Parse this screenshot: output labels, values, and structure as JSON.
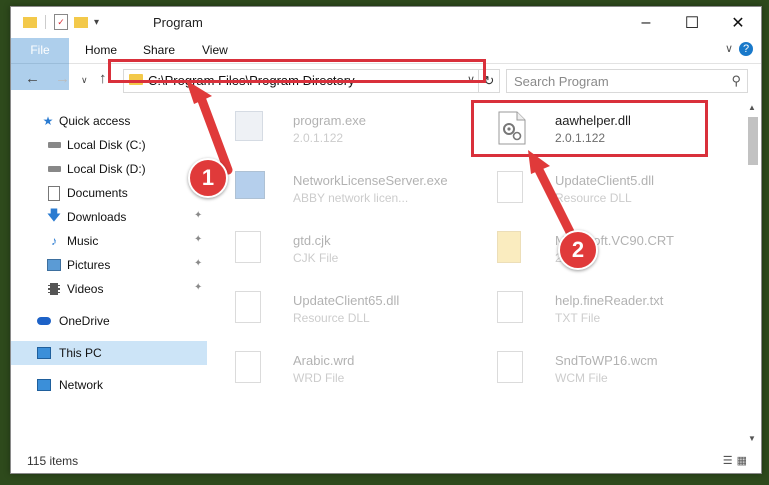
{
  "title": "Program",
  "ribbon": {
    "tabs": [
      {
        "label": "File"
      },
      {
        "label": "Home"
      },
      {
        "label": "Share"
      },
      {
        "label": "View"
      }
    ]
  },
  "address": {
    "path": "C:\\Program Files\\Program Directory"
  },
  "search": {
    "placeholder": "Search Program"
  },
  "sidebar": {
    "items": [
      {
        "label": "Quick access",
        "icon": "star-icon"
      },
      {
        "label": "Local Disk (C:)",
        "icon": "drive-icon"
      },
      {
        "label": "Local Disk (D:)",
        "icon": "drive-icon"
      },
      {
        "label": "Documents",
        "icon": "documents-icon"
      },
      {
        "label": "Downloads",
        "icon": "download-icon",
        "pinned": true
      },
      {
        "label": "Music",
        "icon": "music-icon",
        "pinned": true
      },
      {
        "label": "Pictures",
        "icon": "pictures-icon",
        "pinned": true
      },
      {
        "label": "Videos",
        "icon": "videos-icon",
        "pinned": true
      },
      {
        "label": "OneDrive",
        "icon": "cloud-icon"
      },
      {
        "label": "This PC",
        "icon": "pc-icon",
        "selected": true
      },
      {
        "label": "Network",
        "icon": "network-icon"
      }
    ]
  },
  "files": [
    {
      "name": "program.exe",
      "sub": "2.0.1.122",
      "icon": "exe-icon"
    },
    {
      "name": "aawhelper.dll",
      "sub": "2.0.1.122",
      "icon": "dll-gear-icon",
      "highlighted": true
    },
    {
      "name": "NetworkLicenseServer.exe",
      "sub": "ABBY network licen...",
      "icon": "exe-icon"
    },
    {
      "name": "UpdateClient5.dll",
      "sub": "Resource DLL",
      "icon": "dll-gear-icon"
    },
    {
      "name": "gtd.cjk",
      "sub": "CJK File",
      "icon": "file-icon"
    },
    {
      "name": "Microsoft.VC90.CRT",
      "sub": "2.0.1...",
      "icon": "folder-icon"
    },
    {
      "name": "UpdateClient65.dll",
      "sub": "Resource DLL",
      "icon": "dll-gear-icon"
    },
    {
      "name": "help.fineReader.txt",
      "sub": "TXT File",
      "icon": "file-icon"
    },
    {
      "name": "Arabic.wrd",
      "sub": "WRD File",
      "icon": "file-icon"
    },
    {
      "name": "SndToWP16.wcm",
      "sub": "WCM File",
      "icon": "file-icon"
    }
  ],
  "status": {
    "item_count": "115 items"
  },
  "callouts": [
    "1",
    "2"
  ],
  "colors": {
    "accent": "#1979ca",
    "highlight": "#d9303b",
    "selected": "#cce4f7"
  }
}
